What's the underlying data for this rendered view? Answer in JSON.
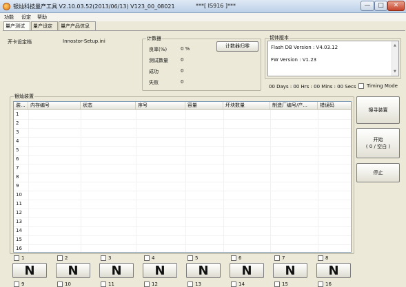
{
  "window": {
    "title": "银灿科技量产工具 V2.10.03.52(2013/06/13)  V123_00_08021",
    "device_tag": "***[ IS916 ]***",
    "minimize": "—",
    "maximize": "□",
    "close": "✕"
  },
  "menu": [
    "功能",
    "设定",
    "帮助"
  ],
  "tabs": [
    "量产测试",
    "量产设定",
    "量产产品信息"
  ],
  "setup_file": {
    "label": "开卡设定档",
    "value": "Innostor-Setup.ini"
  },
  "counter": {
    "title": "计数器",
    "reset_button": "计数器归零",
    "rows": [
      {
        "label": "良率(%)",
        "value": "0 %"
      },
      {
        "label": "测试数量",
        "value": "0"
      },
      {
        "label": "成功",
        "value": "0"
      },
      {
        "label": "失败",
        "value": "0"
      }
    ]
  },
  "firmware": {
    "title": "韧体版本",
    "flash_db": "Flash DB Version :  V4.03.12",
    "fw": "FW Version :  V1.23"
  },
  "timer": {
    "elapsed": "00 Days : 00 Hrs : 00 Mins : 00 Secs",
    "timing_mode": "Timing Mode"
  },
  "device_group": {
    "title": "银灿装置",
    "columns": [
      "装...",
      "内存编号",
      "状态",
      "序号",
      "容量",
      "坏块数量",
      "制造厂编号/产...",
      "错误码"
    ],
    "rows": [
      "1",
      "2",
      "3",
      "4",
      "5",
      "6",
      "7",
      "8",
      "9",
      "10",
      "11",
      "12",
      "13",
      "14",
      "15",
      "16"
    ]
  },
  "actions": {
    "scan": "搜寻装置",
    "start_line1": "开始",
    "start_line2": "( 0 / 空白 )",
    "stop": "停止"
  },
  "ports_row1": [
    {
      "num": "1",
      "state": "N"
    },
    {
      "num": "2",
      "state": "N"
    },
    {
      "num": "3",
      "state": "N"
    },
    {
      "num": "4",
      "state": "N"
    },
    {
      "num": "5",
      "state": "N"
    },
    {
      "num": "6",
      "state": "N"
    },
    {
      "num": "7",
      "state": "N"
    },
    {
      "num": "8",
      "state": "N"
    }
  ],
  "ports_row2": [
    "9",
    "10",
    "11",
    "12",
    "13",
    "14",
    "15",
    "16"
  ]
}
